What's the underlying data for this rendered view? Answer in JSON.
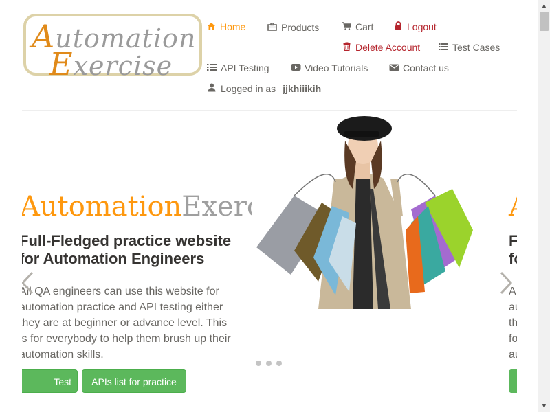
{
  "logo": {
    "line1_cap": "A",
    "line1_rest": "utomation",
    "line2_cap": "E",
    "line2_rest": "xercise"
  },
  "nav": {
    "home": "Home",
    "products": "Products",
    "cart": "Cart",
    "logout": "Logout",
    "delete_account": "Delete Account",
    "test_cases": "Test Cases",
    "api_testing": "API Testing",
    "video_tutorials": "Video Tutorials",
    "contact_us": "Contact us",
    "logged_in_prefix": "Logged in as",
    "username": "jjkhiiikih"
  },
  "slide": {
    "title_a": "Automation",
    "title_e": "Exercise",
    "heading": "Full-Fledged practice website for Automation Engineers",
    "description": "All QA engineers can use this website for automation practice and API testing either they are at beginner or advance level. This is for everybody to help them brush up their automation skills.",
    "button_test_cases": "Test Cases",
    "button_apis": "APIs list for practice"
  },
  "next_slide": {
    "title": "A",
    "heading_lines": [
      "F",
      "fo"
    ],
    "desc_lines": [
      "A",
      "au",
      "th",
      "fo",
      "au"
    ]
  },
  "carousel": {
    "prev_icon": "chevron-left-icon",
    "next_icon": "chevron-right-icon",
    "dots": 3
  },
  "colors": {
    "accent": "#fe980f",
    "danger": "#b5252d",
    "success": "#5cb85c",
    "text": "#696763"
  }
}
